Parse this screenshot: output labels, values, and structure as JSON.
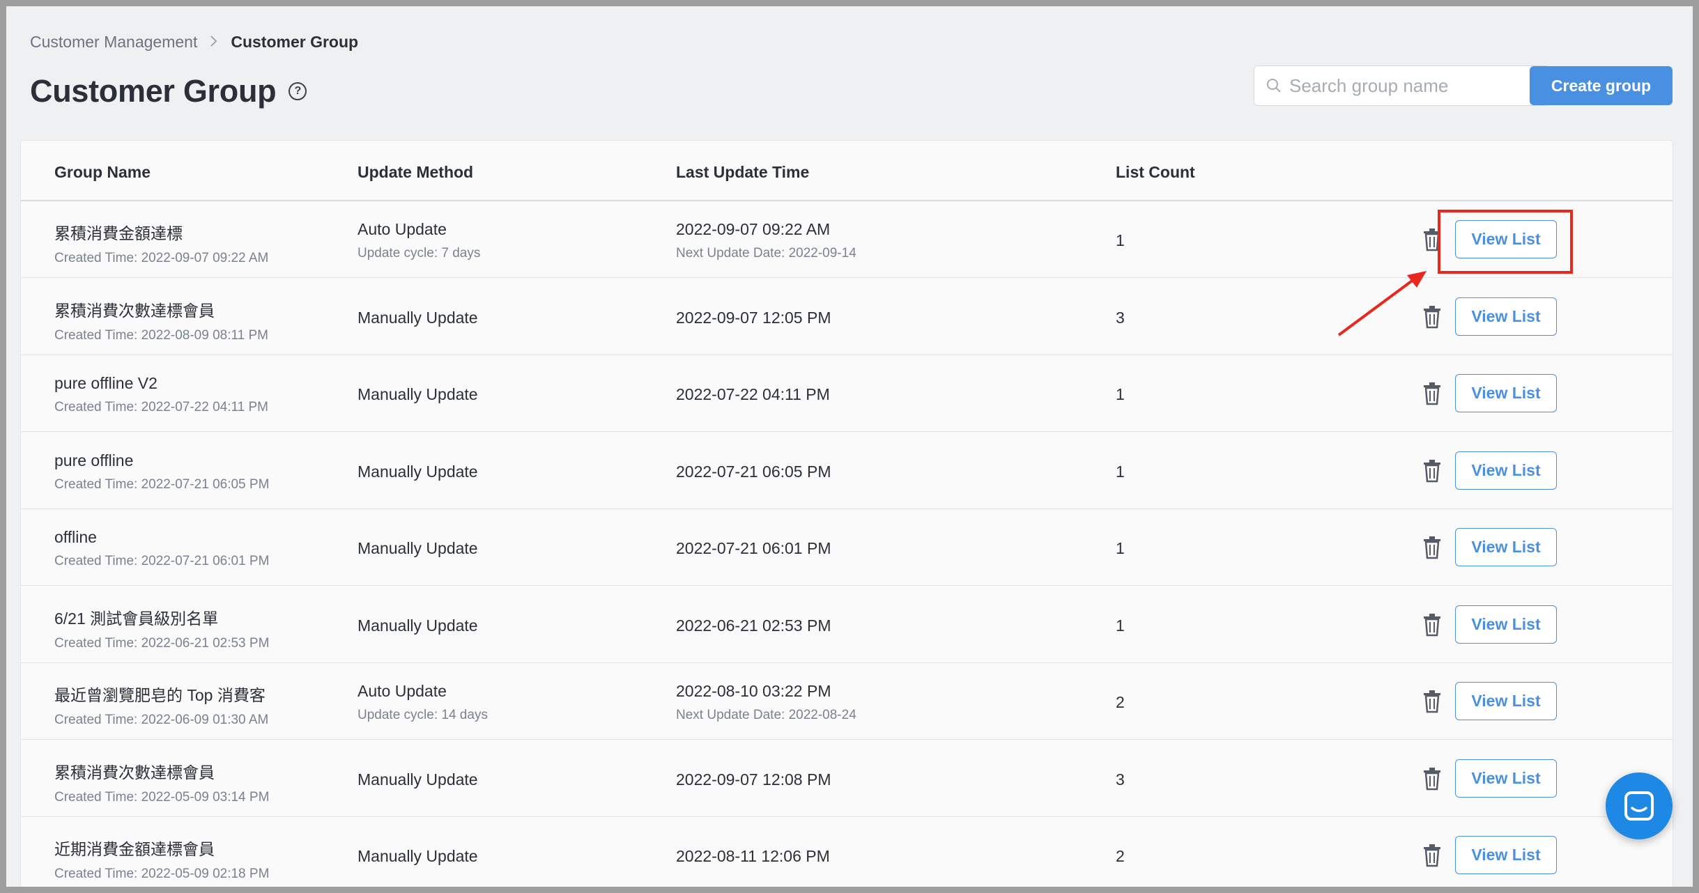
{
  "breadcrumb": {
    "parent": "Customer Management",
    "separator": ">",
    "current": "Customer Group"
  },
  "page": {
    "title": "Customer Group",
    "help_icon": "question-circle-icon"
  },
  "search": {
    "placeholder": "Search group name",
    "value": ""
  },
  "toolbar": {
    "create_label": "Create group"
  },
  "table": {
    "headers": {
      "group_name": "Group Name",
      "update_method": "Update Method",
      "last_update": "Last Update Time",
      "list_count": "List Count"
    },
    "rows": [
      {
        "name": "累積消費金額達標",
        "created": "Created Time: 2022-09-07 09:22 AM",
        "method": "Auto Update",
        "method_sub": "Update cycle: 7 days",
        "last_update": "2022-09-07 09:22 AM",
        "last_update_sub": "Next Update Date: 2022-09-14",
        "count": "1",
        "action": "View List"
      },
      {
        "name": "累積消費次數達標會員",
        "created": "Created Time: 2022-08-09 08:11 PM",
        "method": "Manually Update",
        "method_sub": "",
        "last_update": "2022-09-07 12:05 PM",
        "last_update_sub": "",
        "count": "3",
        "action": "View List"
      },
      {
        "name": "pure offline V2",
        "created": "Created Time: 2022-07-22 04:11 PM",
        "method": "Manually Update",
        "method_sub": "",
        "last_update": "2022-07-22 04:11 PM",
        "last_update_sub": "",
        "count": "1",
        "action": "View List"
      },
      {
        "name": "pure offline",
        "created": "Created Time: 2022-07-21 06:05 PM",
        "method": "Manually Update",
        "method_sub": "",
        "last_update": "2022-07-21 06:05 PM",
        "last_update_sub": "",
        "count": "1",
        "action": "View List"
      },
      {
        "name": "offline",
        "created": "Created Time: 2022-07-21 06:01 PM",
        "method": "Manually Update",
        "method_sub": "",
        "last_update": "2022-07-21 06:01 PM",
        "last_update_sub": "",
        "count": "1",
        "action": "View List"
      },
      {
        "name": "6/21 測試會員級別名單",
        "created": "Created Time: 2022-06-21 02:53 PM",
        "method": "Manually Update",
        "method_sub": "",
        "last_update": "2022-06-21 02:53 PM",
        "last_update_sub": "",
        "count": "1",
        "action": "View List"
      },
      {
        "name": "最近曾瀏覽肥皂的 Top 消費客",
        "created": "Created Time: 2022-06-09 01:30 AM",
        "method": "Auto Update",
        "method_sub": "Update cycle: 14 days",
        "last_update": "2022-08-10 03:22 PM",
        "last_update_sub": "Next Update Date: 2022-08-24",
        "count": "2",
        "action": "View List"
      },
      {
        "name": "累積消費次數達標會員",
        "created": "Created Time: 2022-05-09 03:14 PM",
        "method": "Manually Update",
        "method_sub": "",
        "last_update": "2022-09-07 12:08 PM",
        "last_update_sub": "",
        "count": "3",
        "action": "View List"
      },
      {
        "name": "近期消費金額達標會員",
        "created": "Created Time: 2022-05-09 02:18 PM",
        "method": "Manually Update",
        "method_sub": "",
        "last_update": "2022-08-11 12:06 PM",
        "last_update_sub": "",
        "count": "2",
        "action": "View List"
      }
    ]
  },
  "annotation": {
    "highlight_color": "#e8281c"
  },
  "colors": {
    "accent": "#4a90e2",
    "chat": "#1e88e5"
  },
  "chat_widget": {
    "icon": "chat-bubble-icon"
  }
}
